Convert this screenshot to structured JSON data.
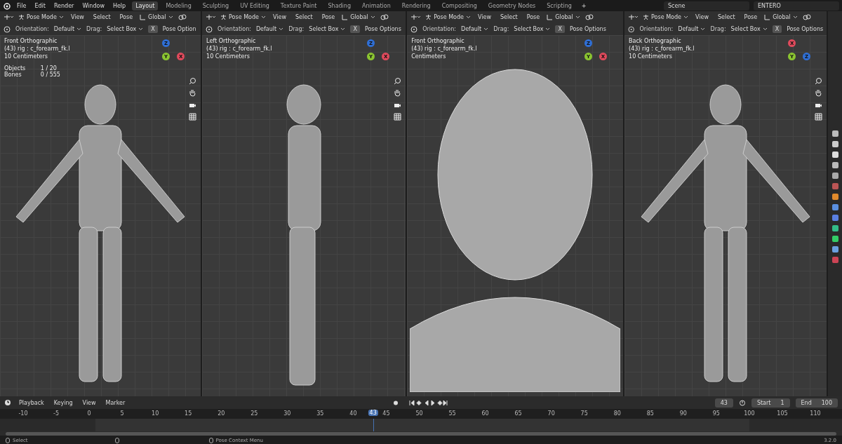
{
  "menus": [
    "File",
    "Edit",
    "Render",
    "Window",
    "Help"
  ],
  "workspaces": [
    {
      "label": "Layout",
      "selected": true
    },
    {
      "label": "Modeling",
      "selected": false
    },
    {
      "label": "Sculpting",
      "selected": false
    },
    {
      "label": "UV Editing",
      "selected": false
    },
    {
      "label": "Texture Paint",
      "selected": false
    },
    {
      "label": "Shading",
      "selected": false
    },
    {
      "label": "Animation",
      "selected": false
    },
    {
      "label": "Rendering",
      "selected": false
    },
    {
      "label": "Compositing",
      "selected": false
    },
    {
      "label": "Geometry Nodes",
      "selected": false
    },
    {
      "label": "Scripting",
      "selected": false
    }
  ],
  "add_workspace": "+",
  "scene": "Scene",
  "view_layer": "ENTERO",
  "viewports": [
    {
      "mode": "Pose Mode",
      "menus": [
        "View",
        "Select",
        "Pose"
      ],
      "transform": "Global",
      "orientation_label": "Orientation:",
      "orientation": "Default",
      "drag_label": "Drag:",
      "drag": "Select Box",
      "x_button": "X",
      "options": "Pose Option",
      "info": [
        "Front Orthographic",
        "(43) rig : c_forearm_fk.l",
        "10 Centimeters"
      ],
      "stats": [
        {
          "label": "Objects",
          "value": "1 / 20"
        },
        {
          "label": "Bones",
          "value": "0 / 555"
        }
      ],
      "axes": [
        {
          "label": "Z",
          "color": "#2f6fd6"
        },
        {
          "label": "Y",
          "color": "#8bc531"
        },
        {
          "label": "X",
          "color": "#e04a5c"
        }
      ],
      "show_navigation": true,
      "kind": "body"
    },
    {
      "mode": "Pose Mode",
      "menus": [
        "View",
        "Select",
        "Pose"
      ],
      "transform": "Global",
      "orientation_label": "Orientation:",
      "orientation": "Default",
      "drag_label": "Drag:",
      "drag": "Select Box",
      "x_button": "X",
      "options": "Pose Options",
      "info": [
        "Left Orthographic",
        "(43) rig : c_forearm_fk.l",
        "10 Centimeters"
      ],
      "axes": [
        {
          "label": "Z",
          "color": "#2f6fd6"
        },
        {
          "label": "Y",
          "color": "#8bc531"
        },
        {
          "label": "X",
          "color": "#e04a5c"
        }
      ],
      "show_navigation": true,
      "kind": "side"
    },
    {
      "mode": "Pose Mode",
      "menus": [
        "View",
        "Select",
        "Pose"
      ],
      "transform": "Global",
      "orientation_label": "Orientation:",
      "orientation": "Default",
      "drag_label": "Drag:",
      "drag": "Select Box",
      "x_button": "X",
      "options": "Pose Options",
      "info": [
        "Front Orthographic",
        "(43) rig : c_forearm_fk.l",
        "Centimeters"
      ],
      "axes": [
        {
          "label": "Z",
          "color": "#2f6fd6"
        },
        {
          "label": "Y",
          "color": "#8bc531"
        },
        {
          "label": "X",
          "color": "#e04a5c"
        }
      ],
      "show_navigation": false,
      "kind": "head"
    },
    {
      "mode": "Pose Mode",
      "menus": [
        "View",
        "Select",
        "Pose"
      ],
      "transform": "Global",
      "orientation_label": "Orientation:",
      "orientation": "Default",
      "drag_label": "Drag:",
      "drag": "Select Box",
      "x_button": "X",
      "options": "Pose Options",
      "info": [
        "Back Orthographic",
        "(43) rig : c_forearm_fk.l",
        "10 Centimeters"
      ],
      "axes": [
        {
          "label": "X",
          "color": "#e04a5c"
        },
        {
          "label": "Y",
          "color": "#8bc531"
        },
        {
          "label": "Z",
          "color": "#2f6fd6"
        }
      ],
      "show_navigation": true,
      "kind": "body"
    }
  ],
  "timeline": {
    "menus": [
      "Playback",
      "Keying",
      "View",
      "Marker"
    ],
    "current_frame": "43",
    "start_label": "Start",
    "start": "1",
    "end_label": "End",
    "end": "100",
    "ticks": [
      "-10",
      "-5",
      "0",
      "5",
      "10",
      "15",
      "20",
      "25",
      "30",
      "35",
      "40",
      "45",
      "50",
      "55",
      "60",
      "65",
      "70",
      "75",
      "80",
      "85",
      "90",
      "95",
      "100",
      "105",
      "110"
    ],
    "playhead": "43"
  },
  "status_bar": {
    "items": [
      {
        "kind": "hint",
        "label": "Select"
      },
      {
        "kind": "icon"
      },
      {
        "kind": "hint",
        "label": "Pose Context Menu"
      }
    ],
    "version": "3.2.0"
  }
}
